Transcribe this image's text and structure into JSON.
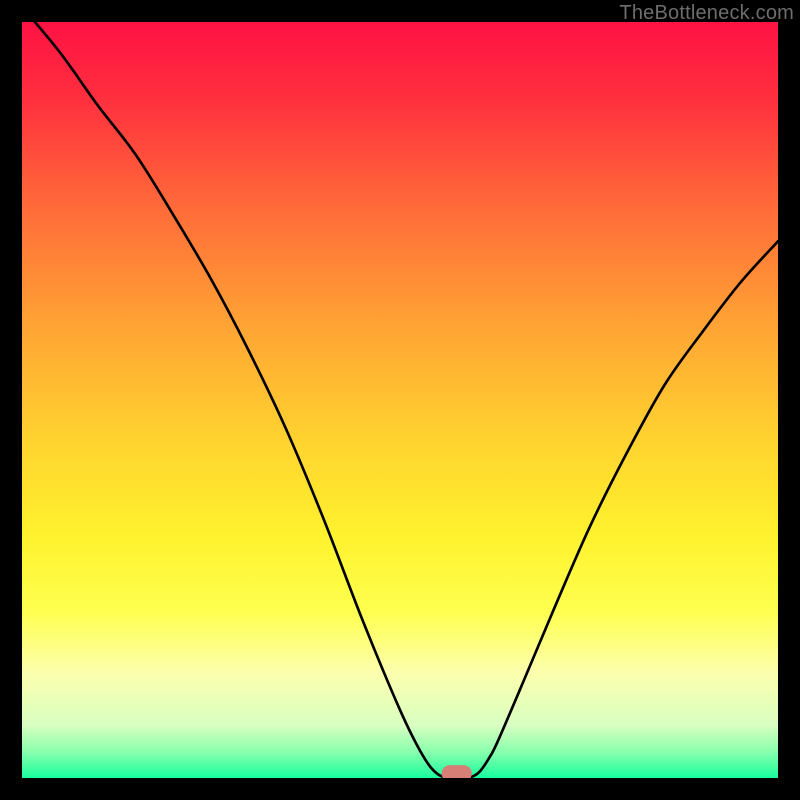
{
  "watermark": "TheBottleneck.com",
  "chart_data": {
    "type": "line",
    "title": "",
    "xlabel": "",
    "ylabel": "",
    "xlim": [
      0,
      100
    ],
    "ylim": [
      0,
      100
    ],
    "legend": false,
    "grid": false,
    "background_gradient": {
      "stops": [
        {
          "offset": 0.0,
          "color": "#ff1244"
        },
        {
          "offset": 0.1,
          "color": "#ff2f3e"
        },
        {
          "offset": 0.25,
          "color": "#ff6c39"
        },
        {
          "offset": 0.4,
          "color": "#ffa334"
        },
        {
          "offset": 0.55,
          "color": "#ffd22f"
        },
        {
          "offset": 0.68,
          "color": "#fff22e"
        },
        {
          "offset": 0.78,
          "color": "#feff4f"
        },
        {
          "offset": 0.86,
          "color": "#fcffad"
        },
        {
          "offset": 0.93,
          "color": "#d9ffc1"
        },
        {
          "offset": 0.965,
          "color": "#8affad"
        },
        {
          "offset": 1.0,
          "color": "#18ff9e"
        }
      ]
    },
    "series": [
      {
        "name": "bottleneck-curve",
        "color": "#000000",
        "width": 2,
        "x": [
          0,
          5,
          10,
          15,
          20,
          25,
          30,
          35,
          40,
          45,
          50,
          53,
          55,
          57,
          59,
          60.5,
          62,
          63,
          66,
          70,
          75,
          80,
          85,
          90,
          95,
          100
        ],
        "values": [
          102,
          96,
          89,
          82.5,
          74.5,
          66,
          56.5,
          46,
          34,
          21,
          9,
          3,
          0.5,
          0,
          0,
          0.8,
          3,
          5,
          12,
          21.5,
          33,
          43,
          52,
          59,
          65.5,
          71
        ]
      }
    ],
    "marker": {
      "name": "bottleneck-marker",
      "x": 57.5,
      "y": 0.6,
      "w": 4.0,
      "h": 2.2,
      "rx": 1.1,
      "color": "#d57f77"
    }
  }
}
